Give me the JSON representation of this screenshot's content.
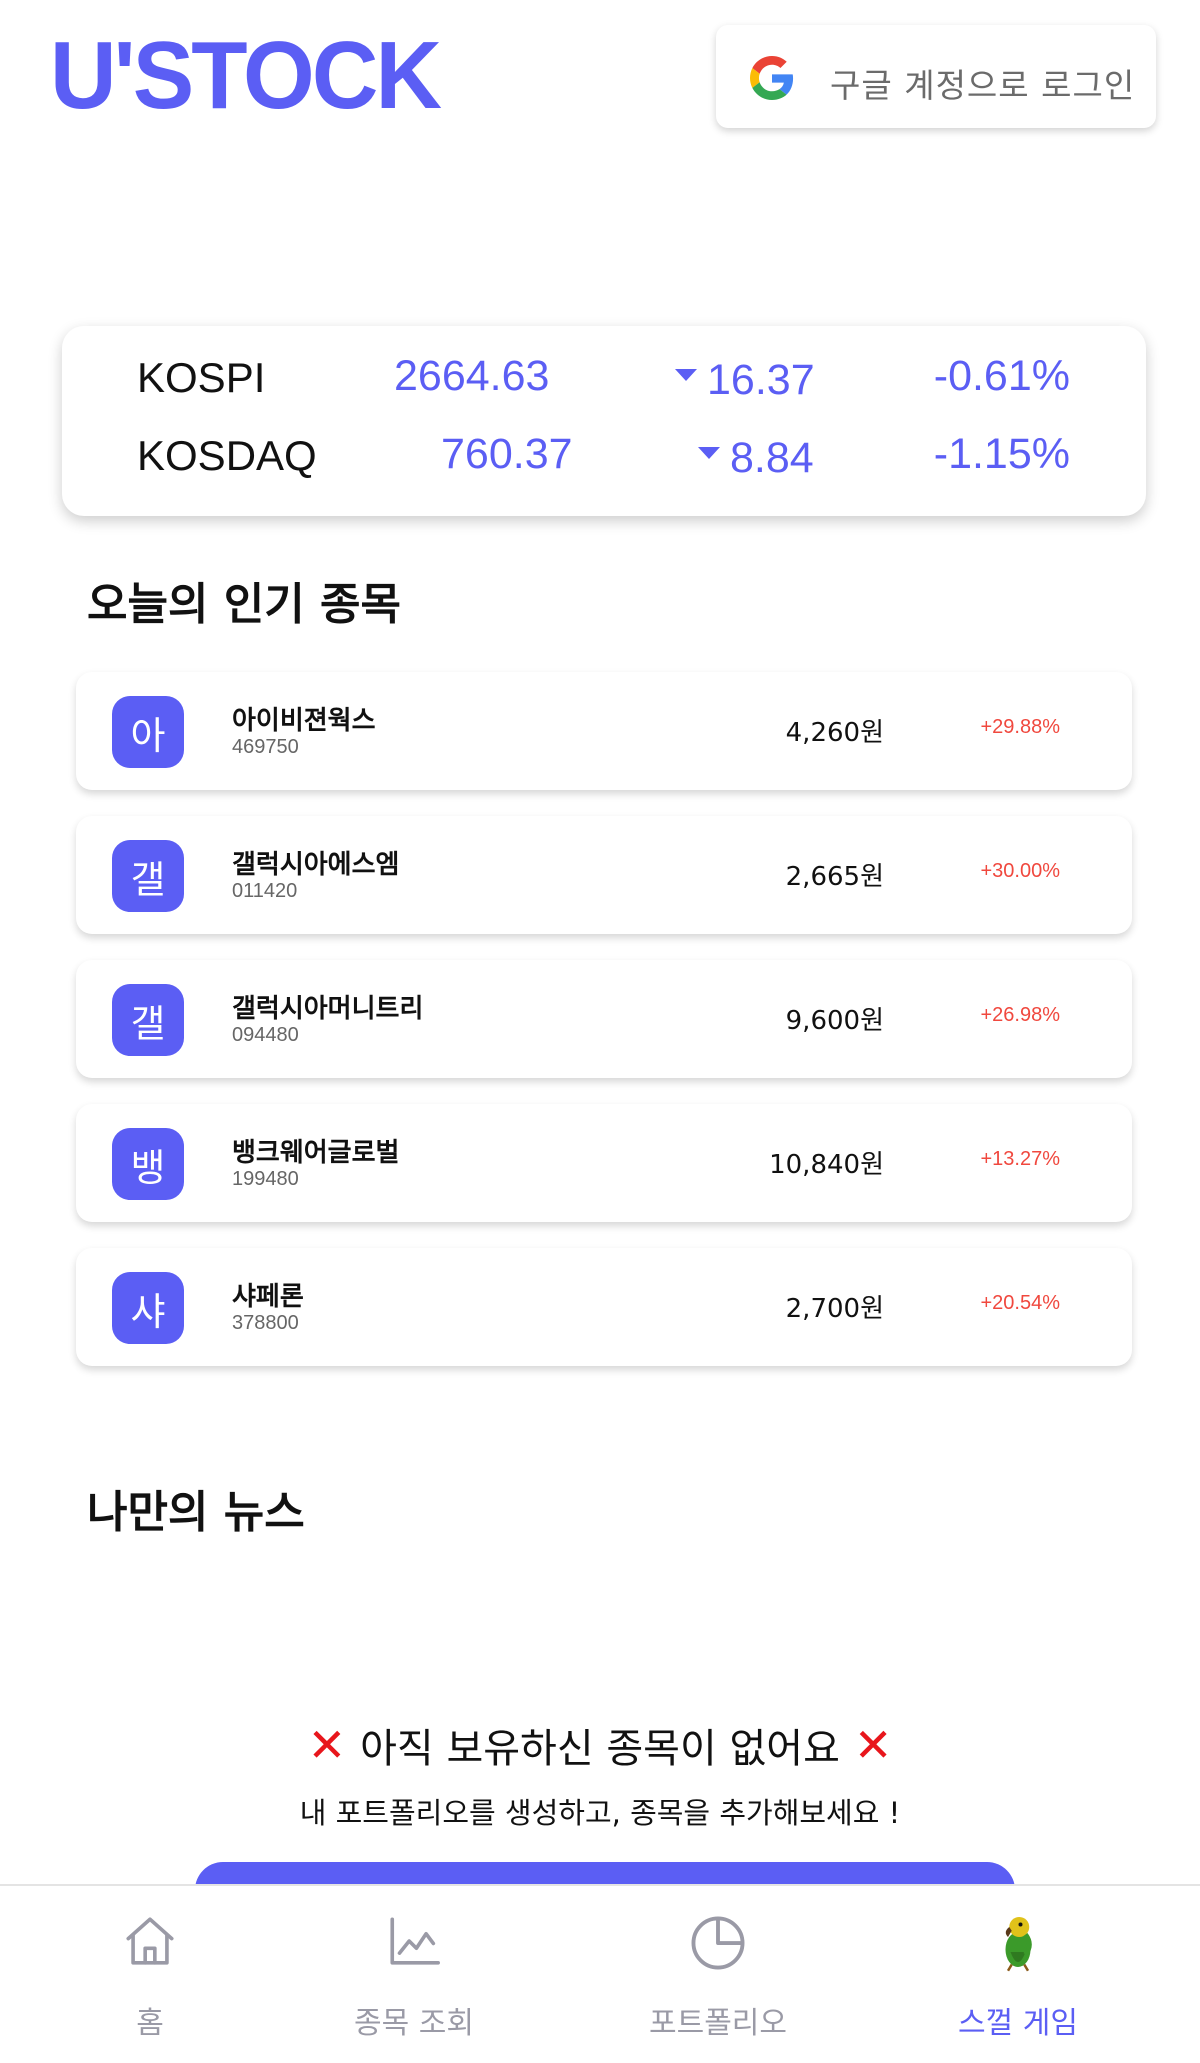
{
  "header": {
    "logo": "U'STOCK",
    "login_label": "구글 계정으로 로그인",
    "login_icon": "google-g-icon"
  },
  "market": [
    {
      "name": "KOSPI",
      "value": "2664.63",
      "change": "16.37",
      "direction": "down",
      "percent": "-0.61%"
    },
    {
      "name": "KOSDAQ",
      "value": "760.37",
      "change": "8.84",
      "direction": "down",
      "percent": "-1.15%"
    }
  ],
  "popular": {
    "title": "오늘의 인기 종목",
    "items": [
      {
        "initial": "아",
        "name": "아이비젼웍스",
        "code": "469750",
        "price": "4,260원",
        "rate": "+29.88%"
      },
      {
        "initial": "갤",
        "name": "갤럭시아에스엠",
        "code": "011420",
        "price": "2,665원",
        "rate": "+30.00%"
      },
      {
        "initial": "갤",
        "name": "갤럭시아머니트리",
        "code": "094480",
        "price": "9,600원",
        "rate": "+26.98%"
      },
      {
        "initial": "뱅",
        "name": "뱅크웨어글로벌",
        "code": "199480",
        "price": "10,840원",
        "rate": "+13.27%"
      },
      {
        "initial": "샤",
        "name": "샤페론",
        "code": "378800",
        "price": "2,700원",
        "rate": "+20.54%"
      }
    ]
  },
  "news": {
    "title": "나만의 뉴스",
    "empty_title": "아직 보유하신 종목이 없어요",
    "empty_icon": "red-x-icon",
    "empty_subtitle": "내 포트폴리오를 생성하고, 종목을 추가해보세요 !"
  },
  "nav": [
    {
      "label": "홈",
      "icon": "home-icon",
      "active": false
    },
    {
      "label": "종목 조회",
      "icon": "chart-line-icon",
      "active": false
    },
    {
      "label": "포트폴리오",
      "icon": "pie-chart-icon",
      "active": false
    },
    {
      "label": "스껄 게임",
      "icon": "parrot-icon",
      "active": true
    }
  ],
  "colors": {
    "accent": "#5b5ef4",
    "rise": "#f0483e",
    "nav_inactive": "#9a9aa6"
  }
}
